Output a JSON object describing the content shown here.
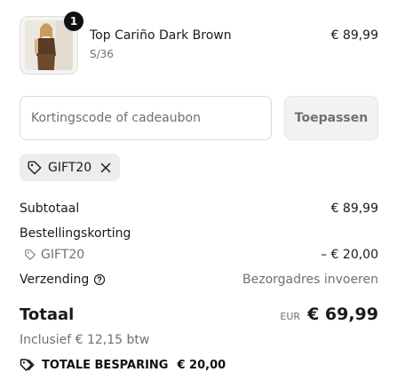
{
  "product": {
    "name": "Top Cariño Dark Brown",
    "variant": "S/36",
    "price": "€ 89,99",
    "quantity": "1"
  },
  "discount": {
    "placeholder": "Kortingscode of cadeaubon",
    "apply_label": "Toepassen",
    "applied_code": "GIFT20"
  },
  "summary": {
    "subtotal_label": "Subtotaal",
    "subtotal_value": "€ 89,99",
    "order_discount_label": "Bestellingskorting",
    "discount_code": "GIFT20",
    "discount_value": "– € 20,00",
    "shipping_label": "Verzending",
    "shipping_value": "Bezorgadres invoeren"
  },
  "total": {
    "label": "Totaal",
    "currency": "EUR",
    "value": "€ 69,99",
    "tax_note": "Inclusief € 12,15 btw"
  },
  "savings": {
    "label": "TOTALE BESPARING",
    "amount": "€ 20,00"
  },
  "icons": {
    "tag": "tag-icon",
    "close": "close-icon",
    "help": "question-circle-icon",
    "savings_tag": "tag-icon"
  },
  "colors": {
    "text": "#1a1a1a",
    "muted": "#707070",
    "chip_bg": "#ededed",
    "button_bg": "#f2f2f2",
    "badge": "#111111"
  }
}
